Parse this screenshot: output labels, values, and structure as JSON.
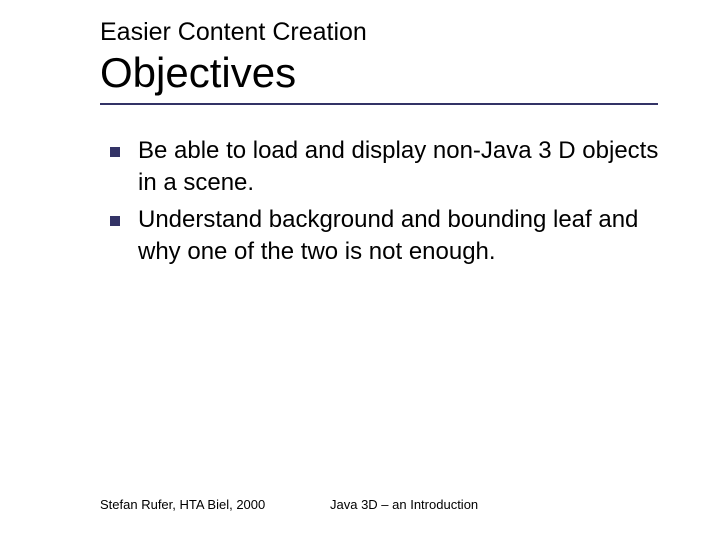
{
  "header": {
    "subtitle": "Easier Content Creation",
    "title": "Objectives"
  },
  "bullets": {
    "items": [
      {
        "text": "Be able to load and display non-Java 3 D objects in a scene."
      },
      {
        "text": "Understand background and bounding leaf and why one of the two is not enough."
      }
    ]
  },
  "footer": {
    "author": "Stefan Rufer, HTA Biel, 2000",
    "course": "Java 3D – an Introduction"
  },
  "colors": {
    "accent": "#333366"
  }
}
